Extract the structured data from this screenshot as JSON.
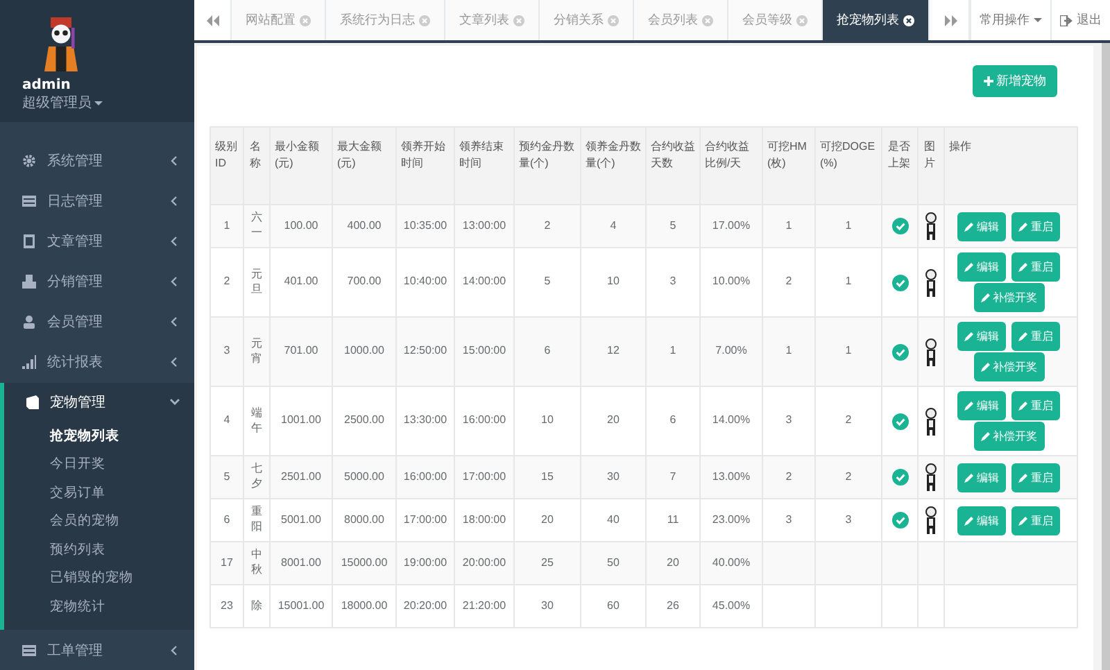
{
  "sidebar": {
    "user": {
      "name": "admin",
      "role": "超级管理员"
    },
    "menu": [
      {
        "label": "系统管理",
        "expanded": false
      },
      {
        "label": "日志管理",
        "expanded": false
      },
      {
        "label": "文章管理",
        "expanded": false
      },
      {
        "label": "分销管理",
        "expanded": false
      },
      {
        "label": "会员管理",
        "expanded": false
      },
      {
        "label": "统计报表",
        "expanded": false
      },
      {
        "label": "宠物管理",
        "expanded": true,
        "children": [
          {
            "label": "抢宠物列表",
            "selected": true
          },
          {
            "label": "今日开奖",
            "selected": false
          },
          {
            "label": "交易订单",
            "selected": false
          },
          {
            "label": "会员的宠物",
            "selected": false
          },
          {
            "label": "预约列表",
            "selected": false
          },
          {
            "label": "已销毁的宠物",
            "selected": false
          },
          {
            "label": "宠物统计",
            "selected": false
          }
        ]
      },
      {
        "label": "工单管理",
        "expanded": false
      }
    ]
  },
  "tabs": [
    {
      "label": "网站配置",
      "selected": false
    },
    {
      "label": "系统行为日志",
      "selected": false
    },
    {
      "label": "文章列表",
      "selected": false
    },
    {
      "label": "分销关系",
      "selected": false
    },
    {
      "label": "会员列表",
      "selected": false
    },
    {
      "label": "会员等级",
      "selected": false
    },
    {
      "label": "抢宠物列表",
      "selected": true
    }
  ],
  "top_menu": {
    "dropdown": "常用操作",
    "logout": "退出"
  },
  "add_button": "新增宠物",
  "table": {
    "columns": [
      "级别ID",
      "名称",
      "最小金额(元)",
      "最大金额(元)",
      "领养开始时间",
      "领养结束时间",
      "预约金丹数量(个)",
      "领养金丹数量(个)",
      "合约收益天数",
      "合约收益比例/天",
      "可挖HM(枚)",
      "可挖DOGE(%)",
      "是否上架",
      "图片",
      "操作"
    ],
    "rows": [
      {
        "cells": [
          "1",
          "六一",
          "100.00",
          "400.00",
          "10:35:00",
          "13:00:00",
          "2",
          "4",
          "5",
          "17.00%",
          "1",
          "1"
        ],
        "listed": true,
        "actions": [
          "编辑",
          "重启"
        ]
      },
      {
        "cells": [
          "2",
          "元旦",
          "401.00",
          "700.00",
          "10:40:00",
          "14:00:00",
          "5",
          "10",
          "3",
          "10.00%",
          "2",
          "1"
        ],
        "listed": true,
        "actions": [
          "编辑",
          "重启",
          "补偿开奖"
        ]
      },
      {
        "cells": [
          "3",
          "元宵",
          "701.00",
          "1000.00",
          "12:50:00",
          "15:00:00",
          "6",
          "12",
          "1",
          "7.00%",
          "1",
          "1"
        ],
        "listed": true,
        "actions": [
          "编辑",
          "重启",
          "补偿开奖"
        ]
      },
      {
        "cells": [
          "4",
          "端午",
          "1001.00",
          "2500.00",
          "13:30:00",
          "16:00:00",
          "10",
          "20",
          "6",
          "14.00%",
          "3",
          "2"
        ],
        "listed": true,
        "actions": [
          "编辑",
          "重启",
          "补偿开奖"
        ]
      },
      {
        "cells": [
          "5",
          "七夕",
          "2501.00",
          "5000.00",
          "16:00:00",
          "17:00:00",
          "15",
          "30",
          "7",
          "13.00%",
          "2",
          "2"
        ],
        "listed": true,
        "actions": [
          "编辑",
          "重启"
        ]
      },
      {
        "cells": [
          "6",
          "重阳",
          "5001.00",
          "8000.00",
          "17:00:00",
          "18:00:00",
          "20",
          "40",
          "11",
          "23.00%",
          "3",
          "3"
        ],
        "listed": true,
        "actions": [
          "编辑",
          "重启"
        ]
      },
      {
        "cells": [
          "17",
          "中秋",
          "8001.00",
          "15000.00",
          "19:00:00",
          "20:00:00",
          "25",
          "50",
          "20",
          "40.00%"
        ]
      },
      {
        "cells": [
          "23",
          "除",
          "15001.00",
          "18000.00",
          "20:20:00",
          "21:20:00",
          "30",
          "60",
          "26",
          "45.00%"
        ]
      }
    ]
  }
}
